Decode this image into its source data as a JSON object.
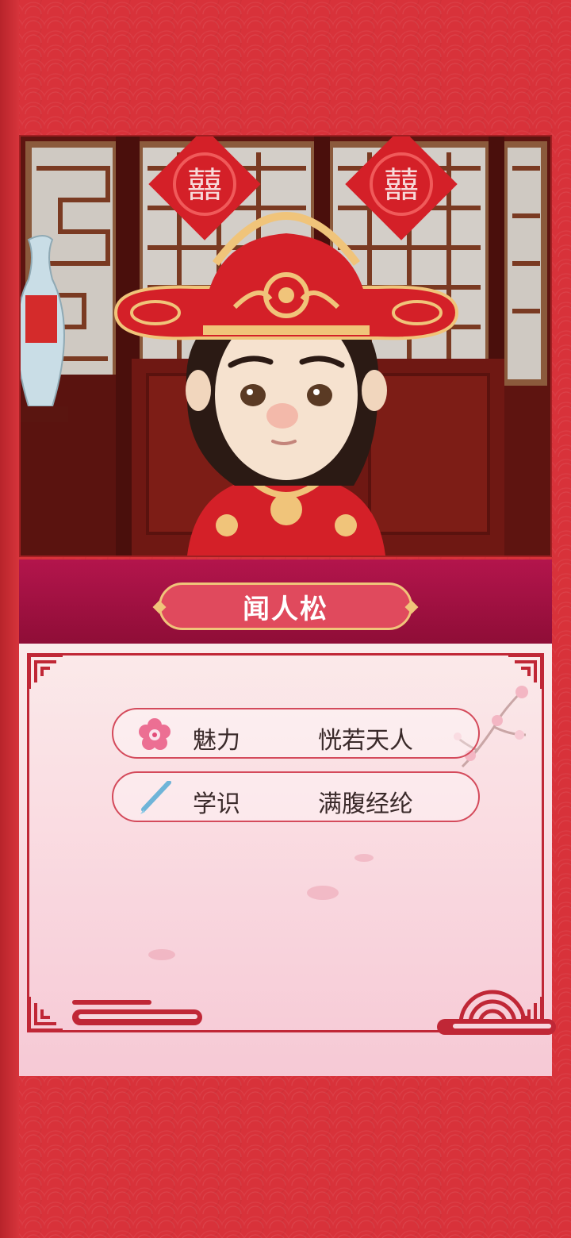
{
  "character": {
    "name": "闻人松"
  },
  "attributes": [
    {
      "label": "魅力",
      "value": "恍若天人",
      "icon": "plum-blossom-icon"
    },
    {
      "label": "学识",
      "value": "满腹经纶",
      "icon": "brush-pen-icon"
    }
  ],
  "colors": {
    "background": "#d8323a",
    "name_bar": "#a3124a",
    "name_plate": "#e04a5d",
    "gold": "#f0c47a",
    "panel": "#f9dde4",
    "frame": "#c02736"
  }
}
